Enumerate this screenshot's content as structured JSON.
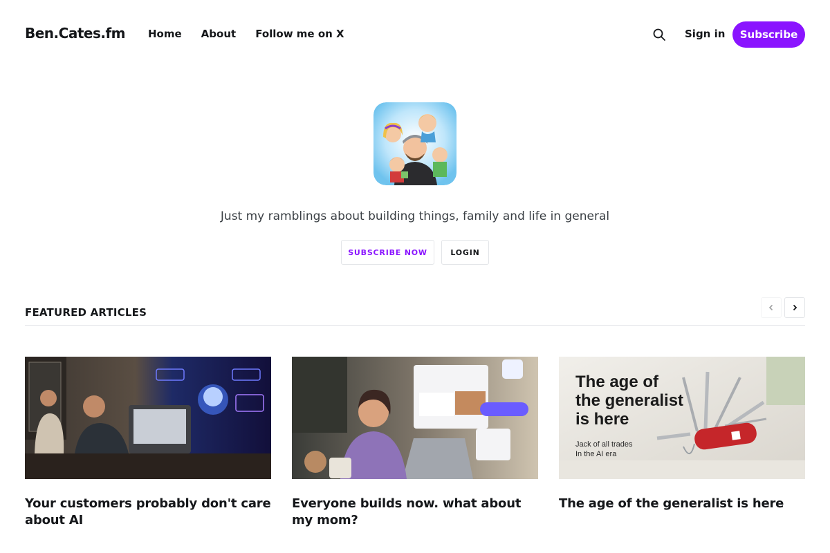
{
  "site": {
    "brand": "Ben.Cates.fm",
    "accent_color": "#8a14ff"
  },
  "nav": {
    "items": [
      {
        "label": "Home"
      },
      {
        "label": "About"
      },
      {
        "label": "Follow me on X"
      }
    ]
  },
  "header": {
    "search_icon": "search-icon",
    "signin_label": "Sign in",
    "subscribe_label": "Subscribe"
  },
  "hero": {
    "tagline": "Just my ramblings about building things, family and life in general",
    "subscribe_now_label": "SUBSCRIBE NOW",
    "login_label": "LOGIN"
  },
  "featured": {
    "heading": "FEATURED ARTICLES",
    "prev_icon": "chevron-left-icon",
    "next_icon": "chevron-right-icon",
    "articles": [
      {
        "title": "Your customers probably don't care about AI"
      },
      {
        "title": "Everyone builds now. what about my mom?"
      },
      {
        "title": "The age of the generalist is here",
        "image_headline": [
          "The age of",
          "the generalist",
          "is here"
        ],
        "image_sub": [
          "Jack of all trades",
          "In the AI era"
        ]
      }
    ]
  }
}
